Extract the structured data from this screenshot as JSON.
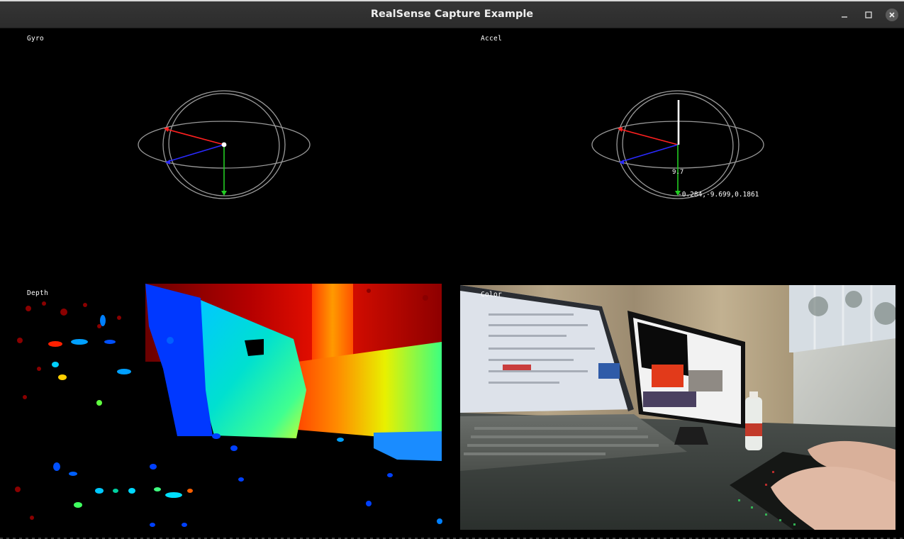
{
  "window": {
    "title": "RealSense Capture Example",
    "controls": {
      "minimize_icon": "minimize-icon",
      "maximize_icon": "maximize-icon",
      "close_icon": "close-icon"
    }
  },
  "panels": {
    "gyro": {
      "label": "Gyro",
      "axis_colors": {
        "x": "#ff2020",
        "y": "#22cc22",
        "z": "#2a2aff"
      },
      "ring_color": "#9a9a9a"
    },
    "accel": {
      "label": "Accel",
      "magnitude": "9.7",
      "readout": "-0.284,-9.699,0.1861",
      "axis_colors": {
        "x": "#ff2020",
        "y": "#22cc22",
        "z": "#2a2aff",
        "vector": "#ffffff"
      },
      "ring_color": "#9a9a9a"
    },
    "depth": {
      "label": "Depth",
      "colormap": "jet"
    },
    "color": {
      "label": "Color"
    }
  }
}
